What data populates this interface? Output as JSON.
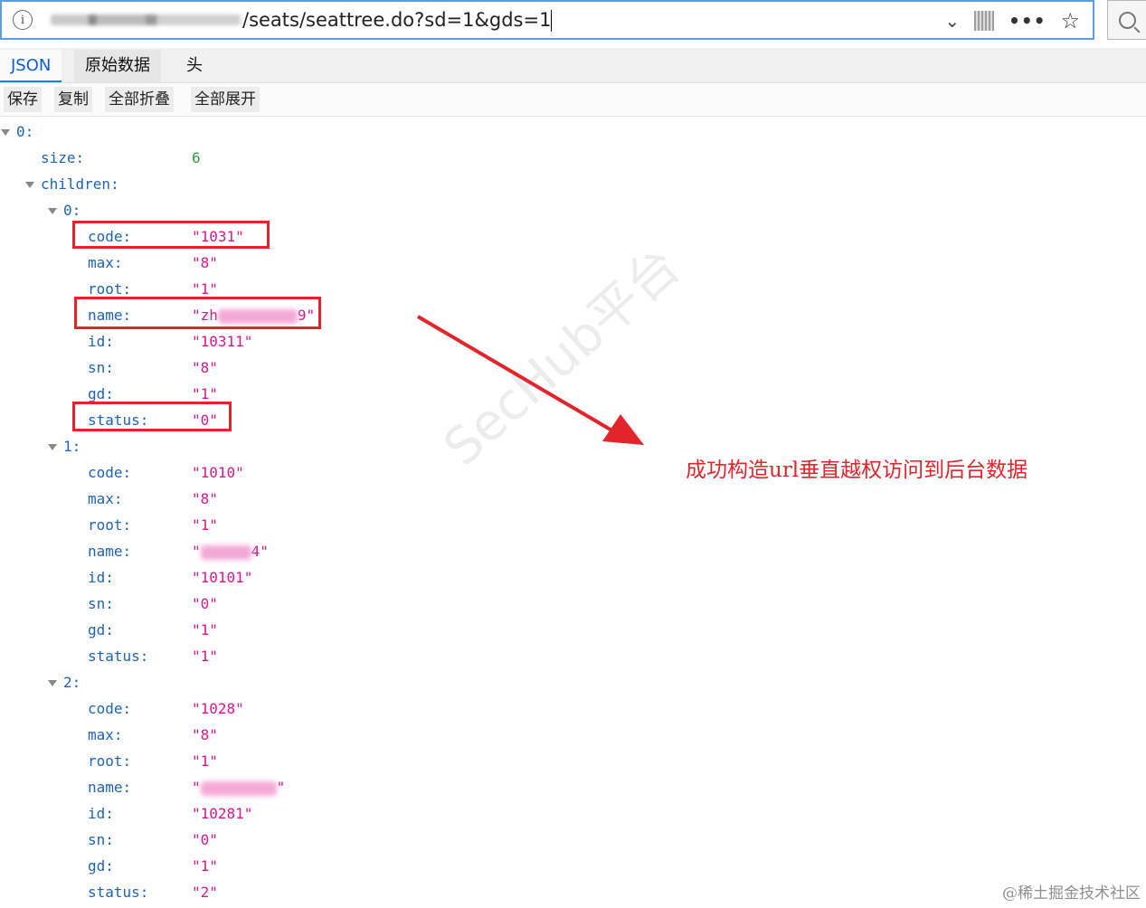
{
  "url_bar": {
    "url_text": "/seats/seattree.do?sd=1&gds=1"
  },
  "tabs": [
    {
      "label": "JSON"
    },
    {
      "label": "原始数据"
    },
    {
      "label": "头"
    }
  ],
  "toolbar": {
    "buttons": [
      {
        "label": "保存"
      },
      {
        "label": "复制"
      },
      {
        "label": "全部折叠"
      },
      {
        "label": "全部展开"
      }
    ]
  },
  "tree": {
    "root_key": "0:",
    "size_key": "size:",
    "size_value": "6",
    "children_key": "children:",
    "children": [
      {
        "index_key": "0:",
        "fields": [
          {
            "key": "code:",
            "value": "\"1031\""
          },
          {
            "key": "max:",
            "value": "\"8\""
          },
          {
            "key": "root:",
            "value": "\"1\""
          },
          {
            "key": "name:",
            "value_prefix": "\"zh",
            "value_suffix": "9\""
          },
          {
            "key": "id:",
            "value": "\"10311\""
          },
          {
            "key": "sn:",
            "value": "\"8\""
          },
          {
            "key": "gd:",
            "value": "\"1\""
          },
          {
            "key": "status:",
            "value": "\"0\""
          }
        ]
      },
      {
        "index_key": "1:",
        "fields": [
          {
            "key": "code:",
            "value": "\"1010\""
          },
          {
            "key": "max:",
            "value": "\"8\""
          },
          {
            "key": "root:",
            "value": "\"1\""
          },
          {
            "key": "name:",
            "value_prefix": "\"",
            "value_suffix": "4\""
          },
          {
            "key": "id:",
            "value": "\"10101\""
          },
          {
            "key": "sn:",
            "value": "\"0\""
          },
          {
            "key": "gd:",
            "value": "\"1\""
          },
          {
            "key": "status:",
            "value": "\"1\""
          }
        ]
      },
      {
        "index_key": "2:",
        "fields": [
          {
            "key": "code:",
            "value": "\"1028\""
          },
          {
            "key": "max:",
            "value": "\"8\""
          },
          {
            "key": "root:",
            "value": "\"1\""
          },
          {
            "key": "name:",
            "value_prefix": "\"",
            "value_suffix": "\""
          },
          {
            "key": "id:",
            "value": "\"10281\""
          },
          {
            "key": "sn:",
            "value": "\"0\""
          },
          {
            "key": "gd:",
            "value": "\"1\""
          },
          {
            "key": "status:",
            "value": "\"2\""
          }
        ]
      }
    ]
  },
  "annotation": {
    "text": "成功构造url垂直越权访问到后台数据",
    "color": "#e3242b"
  },
  "watermark": {
    "text": "SecHub平台"
  },
  "credit": {
    "text": "@稀土掘金技术社区"
  },
  "colors": {
    "key": "#1e63b8",
    "string_value": "#d6198f",
    "number_value": "#2f9e44",
    "highlight": "#e3242b",
    "active_tab": "#0a5fd8"
  },
  "icons": [
    "info-icon",
    "chevron-down-icon",
    "qr-code-icon",
    "more-icon",
    "star-icon",
    "search-icon",
    "expand-triangle-icon",
    "arrow-annotation"
  ]
}
